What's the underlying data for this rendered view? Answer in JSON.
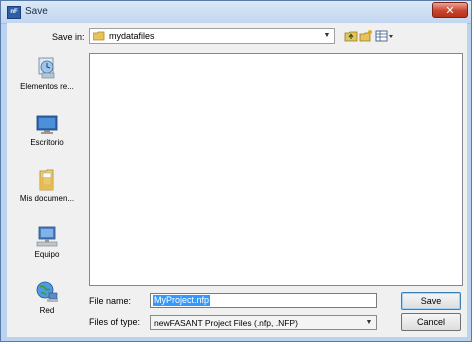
{
  "window": {
    "title": "Save",
    "app_icon_text": "nF",
    "close_label": "✕"
  },
  "toolbar": {
    "save_in_label": "Save in:",
    "save_in_value": "mydatafiles",
    "icons": [
      "up-one-level-icon",
      "new-folder-icon",
      "view-menu-icon"
    ]
  },
  "places": [
    {
      "label": "Elementos re...",
      "icon": "recent-items-icon"
    },
    {
      "label": "Escritorio",
      "icon": "desktop-icon"
    },
    {
      "label": "Mis documen...",
      "icon": "my-documents-icon"
    },
    {
      "label": "Equipo",
      "icon": "computer-icon"
    },
    {
      "label": "Red",
      "icon": "network-icon"
    }
  ],
  "form": {
    "file_name_label": "File name:",
    "file_name_value": "MyProject.nfp",
    "file_type_label": "Files of type:",
    "file_type_value": "newFASANT Project Files (.nfp, .NFP)"
  },
  "buttons": {
    "save": "Save",
    "cancel": "Cancel"
  },
  "colors": {
    "selection": "#3399ff",
    "title_close": "#c8442d"
  }
}
